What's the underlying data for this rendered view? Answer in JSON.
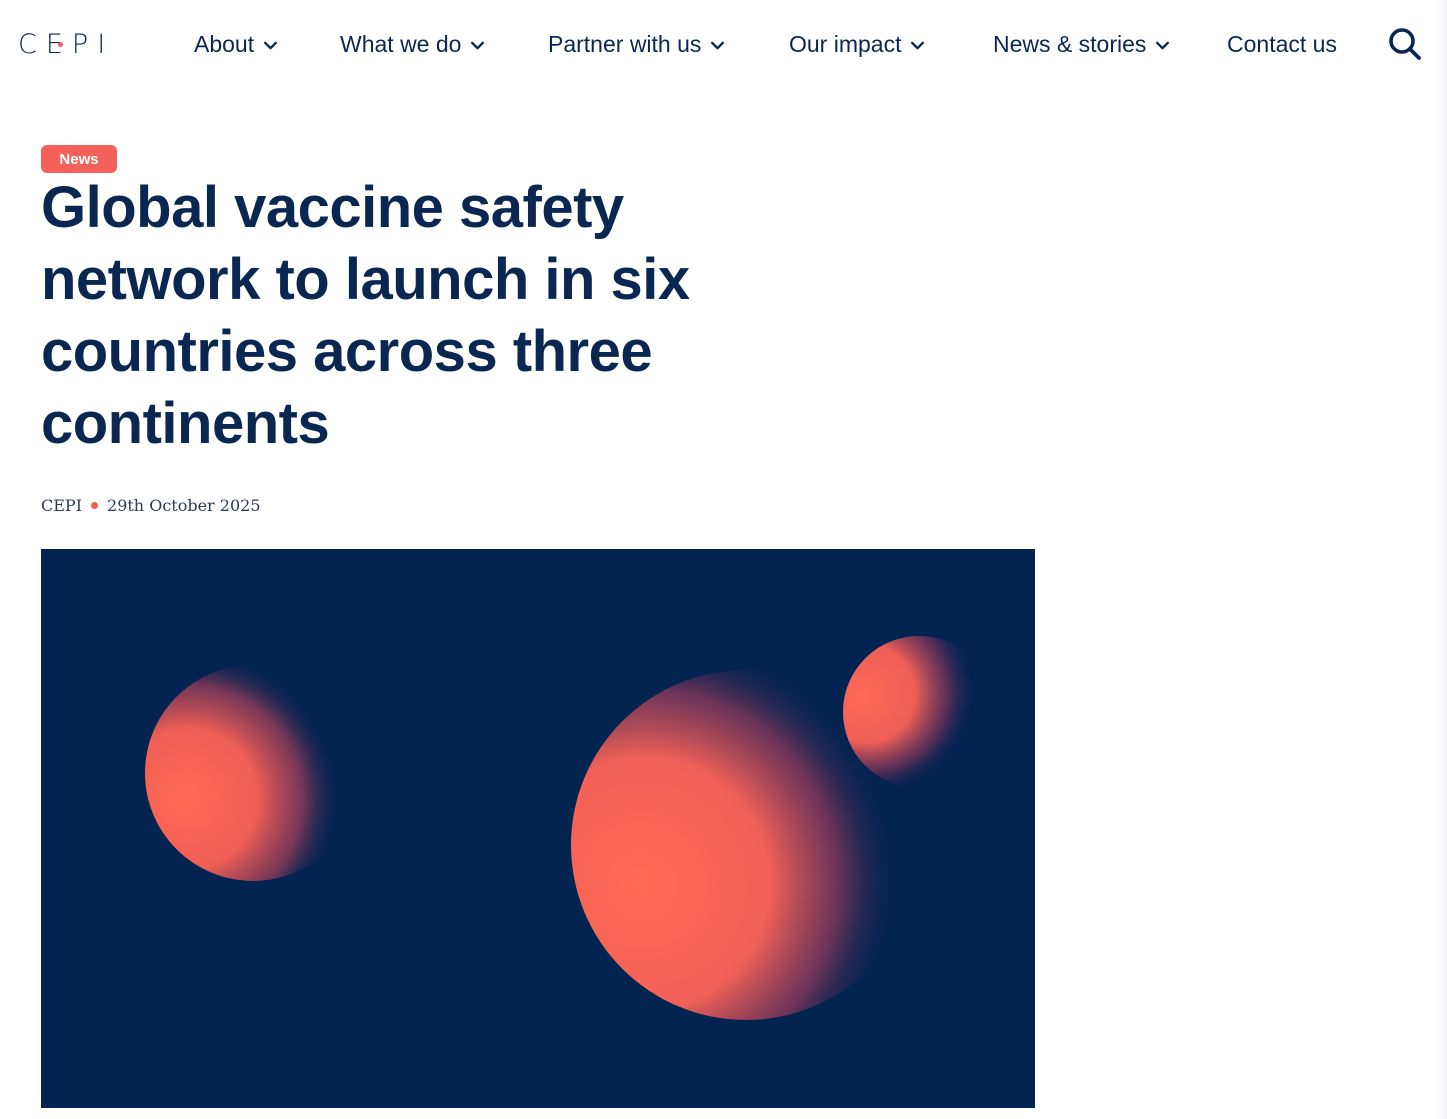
{
  "site": {
    "logo_text": "CEPI"
  },
  "nav": {
    "items": [
      {
        "label": "About",
        "has_dropdown": true
      },
      {
        "label": "What we do",
        "has_dropdown": true
      },
      {
        "label": "Partner with us",
        "has_dropdown": true
      },
      {
        "label": "Our impact",
        "has_dropdown": true
      },
      {
        "label": "News & stories",
        "has_dropdown": true
      },
      {
        "label": "Contact us",
        "has_dropdown": false
      }
    ],
    "search_icon": "search-icon"
  },
  "article": {
    "category_badge": "News",
    "title": "Global vaccine safety network to launch in six countries across three continents",
    "author": "CEPI",
    "date": "29th October 2025"
  },
  "colors": {
    "navy": "#0a2752",
    "hero_background": "#032350",
    "accent_coral": "#f4615a"
  }
}
